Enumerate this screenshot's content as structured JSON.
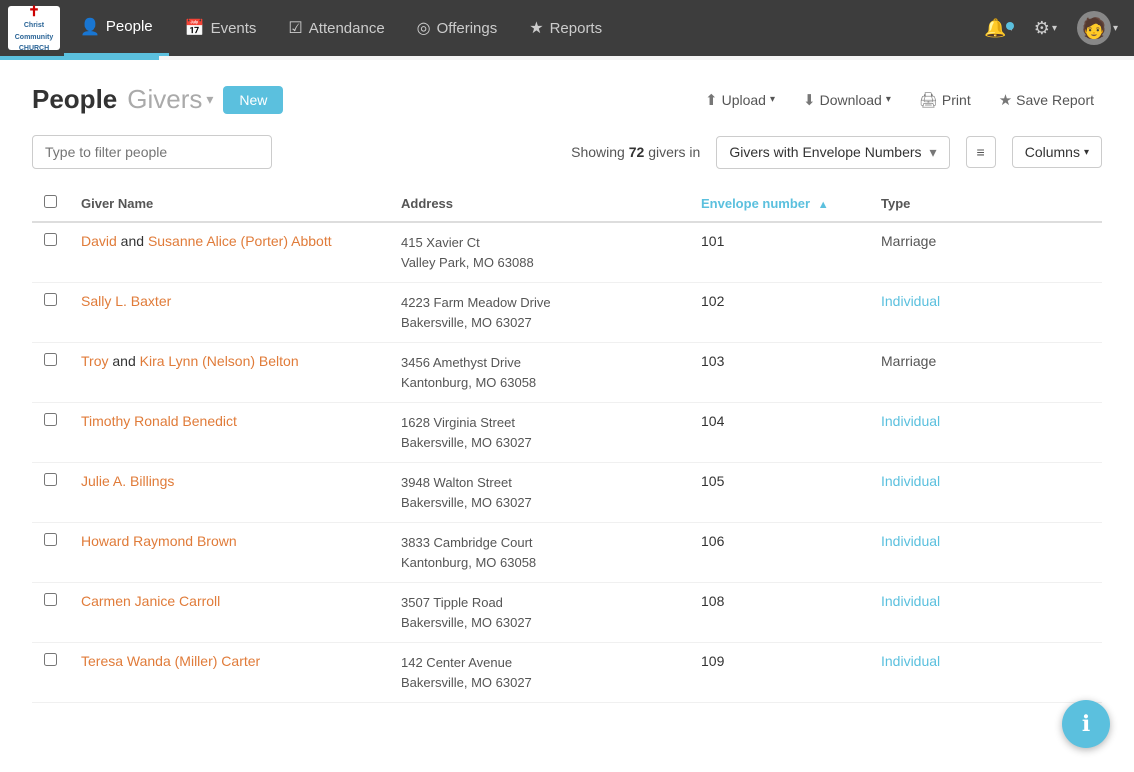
{
  "app": {
    "logo_line1": "Christ",
    "logo_line2": "Community",
    "logo_line3": "CHURCH"
  },
  "nav": {
    "items": [
      {
        "id": "people",
        "label": "People",
        "icon": "👤",
        "active": true
      },
      {
        "id": "events",
        "label": "Events",
        "icon": "📅",
        "active": false
      },
      {
        "id": "attendance",
        "label": "Attendance",
        "icon": "✔",
        "active": false
      },
      {
        "id": "offerings",
        "label": "Offerings",
        "icon": "©",
        "active": false
      },
      {
        "id": "reports",
        "label": "Reports",
        "icon": "★",
        "active": false
      }
    ]
  },
  "page": {
    "title_bold": "People",
    "title_sub": "Givers",
    "new_btn": "New",
    "actions": {
      "upload": "Upload",
      "download": "Download",
      "print": "Print",
      "save_report": "Save Report"
    }
  },
  "filter": {
    "placeholder": "Type to filter people",
    "showing_prefix": "Showing",
    "showing_count": "72",
    "showing_suffix": "givers in",
    "group_name": "Givers with Envelope Numbers",
    "columns_btn": "Columns"
  },
  "table": {
    "columns": {
      "checkbox": "",
      "giver_name": "Giver Name",
      "address": "Address",
      "envelope_number": "Envelope number",
      "type": "Type"
    },
    "rows": [
      {
        "id": 1,
        "name_html": true,
        "name_part1": "David",
        "connector": "and",
        "name_part2": "Susanne Alice (Porter) Abbott",
        "address_line1": "415 Xavier Ct",
        "address_line2": "Valley Park, MO  63088",
        "envelope_number": "101",
        "type": "Marriage",
        "type_class": "type-marriage"
      },
      {
        "id": 2,
        "name_part1": "Sally L. Baxter",
        "connector": "",
        "name_part2": "",
        "address_line1": "4223 Farm Meadow Drive",
        "address_line2": "Bakersville, MO  63027",
        "envelope_number": "102",
        "type": "Individual",
        "type_class": "type-individual"
      },
      {
        "id": 3,
        "name_part1": "Troy",
        "connector": "and",
        "name_part2": "Kira Lynn (Nelson) Belton",
        "address_line1": "3456 Amethyst Drive",
        "address_line2": "Kantonburg, MO  63058",
        "envelope_number": "103",
        "type": "Marriage",
        "type_class": "type-marriage"
      },
      {
        "id": 4,
        "name_part1": "Timothy Ronald Benedict",
        "connector": "",
        "name_part2": "",
        "address_line1": "1628 Virginia Street",
        "address_line2": "Bakersville, MO  63027",
        "envelope_number": "104",
        "type": "Individual",
        "type_class": "type-individual"
      },
      {
        "id": 5,
        "name_part1": "Julie A. Billings",
        "connector": "",
        "name_part2": "",
        "address_line1": "3948 Walton Street",
        "address_line2": "Bakersville, MO  63027",
        "envelope_number": "105",
        "type": "Individual",
        "type_class": "type-individual"
      },
      {
        "id": 6,
        "name_part1": "Howard Raymond Brown",
        "connector": "",
        "name_part2": "",
        "address_line1": "3833 Cambridge Court",
        "address_line2": "Kantonburg, MO  63058",
        "envelope_number": "106",
        "type": "Individual",
        "type_class": "type-individual"
      },
      {
        "id": 7,
        "name_part1": "Carmen Janice Carroll",
        "connector": "",
        "name_part2": "",
        "address_line1": "3507 Tipple Road",
        "address_line2": "Bakersville, MO  63027",
        "envelope_number": "108",
        "type": "Individual",
        "type_class": "type-individual"
      },
      {
        "id": 8,
        "name_part1": "Teresa Wanda (Miller) Carter",
        "connector": "",
        "name_part2": "",
        "address_line1": "142 Center Avenue",
        "address_line2": "Bakersville, MO  63027",
        "envelope_number": "109",
        "type": "Individual",
        "type_class": "type-individual"
      }
    ]
  },
  "fab": {
    "label": "ℹ"
  }
}
